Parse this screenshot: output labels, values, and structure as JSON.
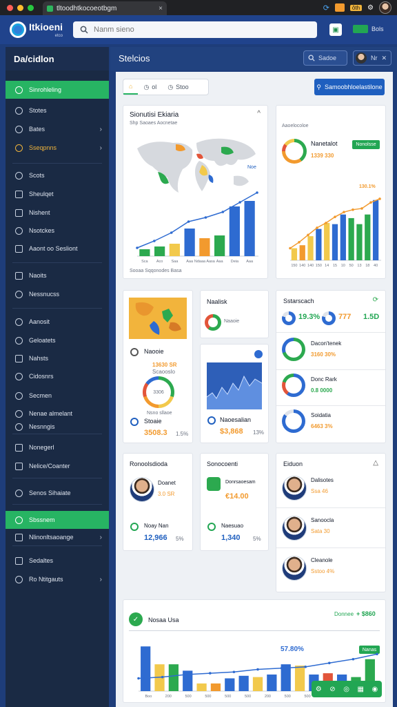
{
  "browser": {
    "tab_title": "tltoodhtkocoeotbgm",
    "tab_close": "×",
    "ext_badge": "ôth"
  },
  "topbar": {
    "logo_text": "Itkioeni",
    "logo_sub": "etco",
    "search_placeholder": "Nanm sieno",
    "status_text": "Bols"
  },
  "sidebar": {
    "title": "Da/cidlon",
    "items": [
      {
        "label": "Sinrohleling"
      },
      {
        "label": "Stotes"
      },
      {
        "label": "Bates"
      },
      {
        "label": "Sseqpnns"
      },
      {
        "label": "Scots"
      },
      {
        "label": "Sheulqet"
      },
      {
        "label": "Nishent"
      },
      {
        "label": "Nsotckes"
      },
      {
        "label": "Aaont oo Sesliont"
      },
      {
        "label": "Naoits"
      },
      {
        "label": "Nessnucss"
      },
      {
        "label": "Aanosit"
      },
      {
        "label": "Geloatets"
      },
      {
        "label": "Nahsts"
      },
      {
        "label": "Cidosnrs"
      },
      {
        "label": "Secmen"
      },
      {
        "label": "Nenae almelant"
      },
      {
        "label": "Nesnngis"
      },
      {
        "label": "Nonegerl"
      },
      {
        "label": "Nelice/Coanter"
      },
      {
        "label": "Senos Sihaiate"
      },
      {
        "label": "Sbssnem"
      },
      {
        "label": "Nlinonltsaoange"
      },
      {
        "label": "Sedaltes"
      },
      {
        "label": "Ro Ntitgauts"
      }
    ]
  },
  "header": {
    "title": "Stelcios",
    "search_label": "Sadoe",
    "profile_label": "Nr"
  },
  "toolbar": {
    "tab_2": "ol",
    "tab_3": "Stoo",
    "primary_button": "Samoobhloelastilone"
  },
  "cards": {
    "world": {
      "title": "Sionutisi Ekiaria",
      "subtitle": "Shp Saoaes Aocnetae",
      "axis_labels": [
        "Sca",
        "Aco",
        "Saa",
        "Aaa",
        "Ndaaa Aasa",
        "Aaa",
        "Deia",
        "Aaa"
      ],
      "map_note": "Noe",
      "footer": "Sooaa Sqqonodes Basa"
    },
    "forecast": {
      "caption": "Aaoelocoloe",
      "title": "Nanetalot",
      "value": "1339 330",
      "badge": "Nonolsse",
      "peak_label": "130.1%"
    },
    "heat_map": {
      "title": "Naooie",
      "value": "13630 SR",
      "sub": "Scaooslo"
    },
    "donut_score": {
      "title": "Naooie",
      "value": "3306",
      "sub": "Nsno sllaoe",
      "footer_label": "Stoaie",
      "footer_value": "3508.3",
      "footer_pct": "1.5%"
    },
    "ring_block": {
      "title": "Naalisk",
      "sub": "Naaoie"
    },
    "wave": {
      "footer_label": "Naoesalian",
      "footer_value": "$3,868",
      "footer_pct": "13%"
    },
    "stats": {
      "title": "Sstarscach",
      "v1": "19.3%",
      "v2": "777",
      "v3": "1.5D",
      "rows": [
        {
          "label": "Dacon'tenek",
          "value": "3160 30%"
        },
        {
          "label": "Donc Rark",
          "value": "0.8 0000"
        },
        {
          "label": "Soidatia",
          "value": "6463 3%"
        }
      ]
    },
    "person_a": {
      "title": "Ronoolsdioda",
      "name": "Doanet",
      "value": "3.0 SR",
      "row_label": "Noay Nan",
      "row_value": "12,966",
      "row_pct": "5%"
    },
    "person_b": {
      "title": "Sonocoenti",
      "name": "Donrsaoesam",
      "value": "€14.00",
      "row_label": "Naesuao",
      "row_value": "1,340",
      "row_pct": "5%"
    },
    "people": {
      "title": "Eiduon",
      "rows": [
        {
          "name": "Dalisotes",
          "value": "Ssa 46"
        },
        {
          "name": "Sanoocla",
          "value": "Sata 30"
        },
        {
          "name": "Cleanole",
          "value": "Sstoo 4%"
        }
      ]
    },
    "bottom": {
      "title": "Nosaa Usa",
      "right_label": "Donnee",
      "right_value": "+ $860",
      "peak_label": "57.80%",
      "badge": "Nanas"
    }
  },
  "charts_style": {
    "blue": "#2e6bd1",
    "green": "#2ca94f",
    "orange": "#f29a2e",
    "yellow": "#f2c94c",
    "red": "#e2553a",
    "teal": "#1aa3e0"
  },
  "chart_data": [
    {
      "type": "bar",
      "title": "Sionutisi Ekiaria",
      "categories": [
        "Sca",
        "Aco",
        "Saa",
        "Aaa",
        "Ndaaa Aasa",
        "Aaa",
        "Deia",
        "Aaa"
      ],
      "values": [
        10,
        14,
        18,
        40,
        26,
        30,
        72,
        80
      ],
      "colors": [
        "#2ca94f",
        "#2ca94f",
        "#f2c94c",
        "#2e6bd1",
        "#f29a2e",
        "#2ca94f",
        "#2e6bd1",
        "#2e6bd1"
      ],
      "line": [
        12,
        22,
        34,
        50,
        56,
        64,
        78,
        92
      ],
      "ylim": [
        0,
        100
      ]
    },
    {
      "type": "bar",
      "title": "Nanetalot",
      "categories": [
        "150",
        "140",
        "140",
        "150",
        "14",
        "15",
        "10",
        "50",
        "13",
        "18",
        "40"
      ],
      "values": [
        20,
        25,
        40,
        52,
        62,
        60,
        76,
        70,
        60,
        76,
        100
      ],
      "colors": [
        "#f2c94c",
        "#f29a2e",
        "#f2c94c",
        "#2e6bd1",
        "#f2c94c",
        "#2e6bd1",
        "#2e6bd1",
        "#2ca94f",
        "#2ca94f",
        "#2ca94f",
        "#2e6bd1"
      ],
      "line": [
        20,
        30,
        42,
        54,
        62,
        72,
        80,
        84,
        86,
        96,
        102
      ],
      "ylim": [
        0,
        110
      ]
    },
    {
      "type": "bar",
      "title": "Nosaa Usa",
      "categories": [
        "Boo",
        "200",
        "500",
        "500",
        "500",
        "500",
        "200",
        "500",
        "500",
        "500",
        "500",
        "500"
      ],
      "values": [
        70,
        42,
        42,
        32,
        12,
        12,
        20,
        24,
        22,
        26,
        42,
        40,
        26,
        28,
        26,
        22,
        50
      ],
      "colors": [
        "#2e6bd1",
        "#f2c94c",
        "#2ca94f",
        "#2e6bd1",
        "#f2c94c",
        "#f29a2e",
        "#2e6bd1",
        "#2e6bd1",
        "#f2c94c",
        "#2e6bd1",
        "#2e6bd1",
        "#f2c94c",
        "#2e6bd1",
        "#e2553a",
        "#2e6bd1",
        "#2ca94f",
        "#2ca94f"
      ],
      "line": [
        20,
        22,
        26,
        28,
        30,
        34,
        36,
        38,
        44,
        50,
        58
      ],
      "ylim": [
        0,
        80
      ]
    }
  ]
}
